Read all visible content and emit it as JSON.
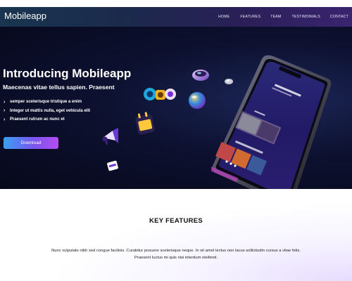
{
  "header": {
    "brand": "Mobileapp",
    "nav": [
      {
        "label": "HOME"
      },
      {
        "label": "FEATURES"
      },
      {
        "label": "TEAM"
      },
      {
        "label": "TESTIMONIALS"
      },
      {
        "label": "CONTACT"
      }
    ]
  },
  "hero": {
    "title": "Introducing Mobileapp",
    "subtitle": "Maecenas vitae tellus sapien. Praesent",
    "features": [
      "semper scelerisque tristique a enim",
      "Integer ut mattis nulla, eget vehicula elit",
      "Praesent rutrum ac nunc et"
    ],
    "download_label": "Download"
  },
  "key_features": {
    "heading": "KEY FEATURES",
    "text": "Nunc vulputate nibh sed congue facilisis. Curabitur posuere scelerisque neque. In sit amet lectus non lacus sollicitudin cursus a vitae felis. Praesent luctus mi quis nisi interdum eleifend."
  },
  "colors": {
    "header_start": "#1a3550",
    "header_end": "#3a2470",
    "hero_bg": "#06081a",
    "button_start": "#3aa0f0",
    "button_end": "#b54df0"
  },
  "icons": [
    "chevron-right-icon",
    "3d-disc-icon",
    "3d-speaker-icon",
    "3d-bubble-icon",
    "3d-calendar-icon",
    "3d-megaphone-icon",
    "3d-card-icon",
    "smartphone-mockup"
  ]
}
